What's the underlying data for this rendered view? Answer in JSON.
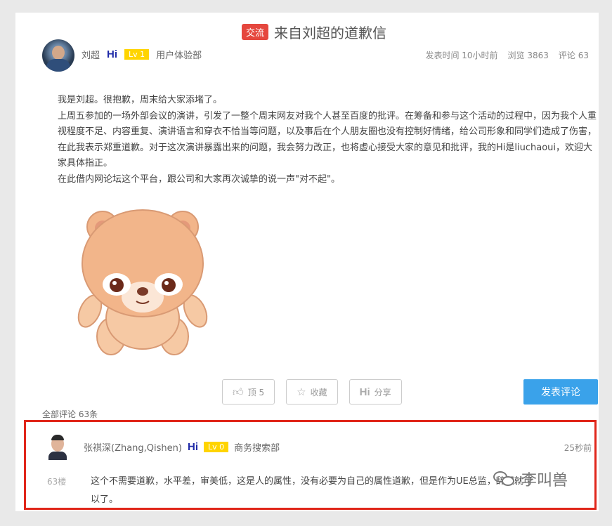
{
  "post": {
    "tag": "交流",
    "title": "来自刘超的道歉信",
    "author": "刘超",
    "hi_label": "Hi",
    "level": "Lv 1",
    "department": "用户体验部",
    "post_time": "发表时间 10小时前",
    "views": "浏览 3863",
    "comments": "评论 63",
    "paragraphs": [
      "我是刘超。很抱歉，周末给大家添堵了。",
      "上周五参加的一场外部会议的演讲，引发了一整个周末网友对我个人甚至百度的批评。在筹备和参与这个活动的过程中，因为我个人重视程度不足、内容重复、演讲语言和穿衣不恰当等问题，以及事后在个人朋友圈也没有控制好情绪，给公司形象和同学们造成了伤害，在此我表示郑重道歉。对于这次演讲暴露出来的问题，我会努力改正，也将虚心接受大家的意见和批评，我的Hi是liuchaoui，欢迎大家具体指正。",
      "在此借内网论坛这个平台，跟公司和大家再次诚挚的说一声\"对不起\"。"
    ]
  },
  "actions": {
    "like": "顶 5",
    "favorite": "收藏",
    "share_hi": "Hi",
    "share": "分享",
    "submit": "发表评论"
  },
  "comments_section": {
    "count_label": "全部评论 63条",
    "comment": {
      "author": "张祺深(Zhang,Qishen)",
      "hi_label": "Hi",
      "level": "Lv 0",
      "department": "商务搜索部",
      "time": "25秒前",
      "floor": "63楼",
      "text": "这个不需要道歉，水平差，审美低，这是人的属性，没有必要为自己的属性道歉，但是作为UE总监，辞职就可以了。"
    }
  },
  "watermark": {
    "text": "李叫兽",
    "icon": "wechat-icon"
  }
}
